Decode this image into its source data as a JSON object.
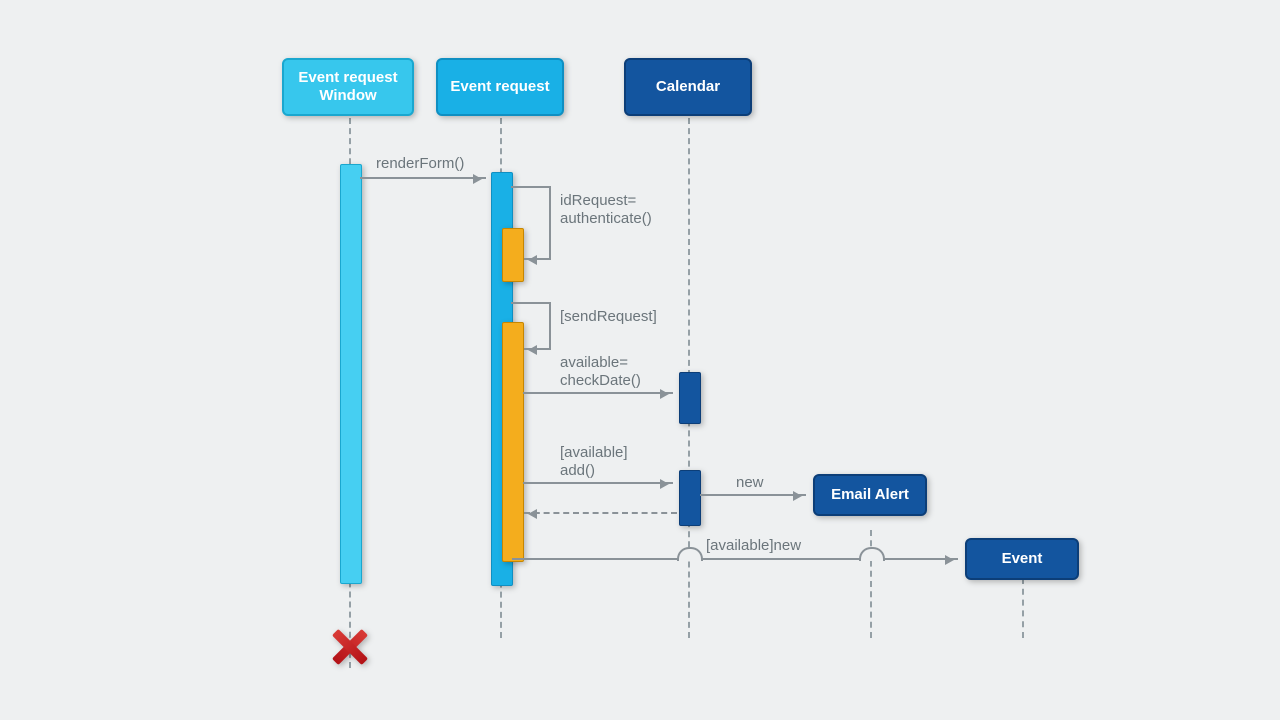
{
  "participants": {
    "p1": "Event request Window",
    "p2": "Event request",
    "p3": "Calendar",
    "p4": "Email Alert",
    "p5": "Event"
  },
  "messages": {
    "m1": "renderForm()",
    "m2a": "idRequest=",
    "m2b": "authenticate()",
    "m3": "[sendRequest]",
    "m4a": "available=",
    "m4b": "checkDate()",
    "m5a": "[available]",
    "m5b": "add()",
    "m6": "new",
    "m7": "[available]new"
  },
  "colors": {
    "p1_fill": "#37c7ed",
    "p1_border": "#1aa7cf",
    "p2_fill": "#19b0e6",
    "p2_border": "#0f8fc2",
    "p3_fill": "#13559f",
    "p3_border": "#0c3e78",
    "exec_orange": "#f4ad1d",
    "exec_orange_border": "#c78600"
  }
}
